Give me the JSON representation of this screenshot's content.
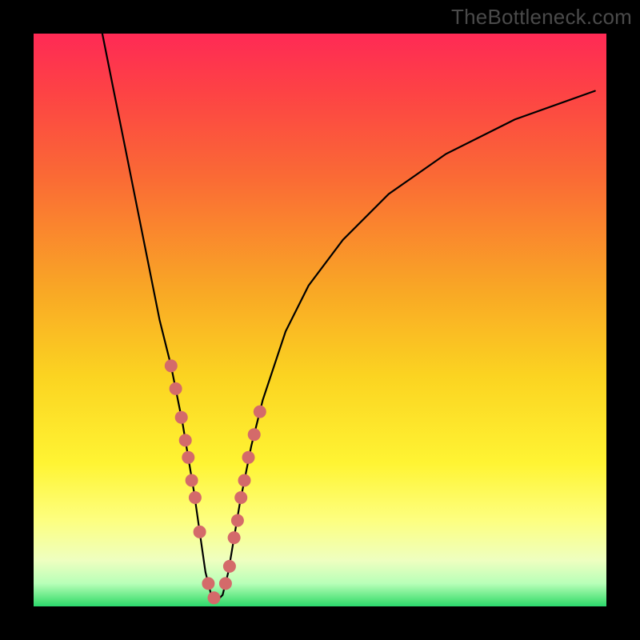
{
  "watermark": "TheBottleneck.com",
  "colors": {
    "curve_stroke": "#000000",
    "marker_fill": "#d46a6a",
    "frame_bg": "#000000",
    "gradient_top": "#ff2a55",
    "gradient_bottom": "#2bd86e"
  },
  "chart_data": {
    "type": "line",
    "title": "",
    "xlabel": "",
    "ylabel": "",
    "xlim": [
      0,
      100
    ],
    "ylim": [
      0,
      100
    ],
    "grid": false,
    "series": [
      {
        "name": "bottleneck-curve",
        "x": [
          12,
          14,
          16,
          18,
          20,
          22,
          24,
          26,
          27,
          28,
          29,
          30,
          31,
          32,
          33,
          34,
          35,
          36,
          38,
          40,
          44,
          48,
          54,
          62,
          72,
          84,
          98
        ],
        "y": [
          100,
          90,
          80,
          70,
          60,
          50,
          42,
          32,
          26,
          20,
          13,
          6,
          2,
          1,
          2,
          6,
          12,
          18,
          28,
          36,
          48,
          56,
          64,
          72,
          79,
          85,
          90
        ]
      }
    ],
    "markers": {
      "name": "highlighted-points",
      "x": [
        24.0,
        24.8,
        25.8,
        26.5,
        27.0,
        27.6,
        28.2,
        29.0,
        30.5,
        31.5,
        33.5,
        34.2,
        35.0,
        35.6,
        36.2,
        36.8,
        37.5,
        38.5,
        39.5
      ],
      "y": [
        42.0,
        38.0,
        33.0,
        29.0,
        26.0,
        22.0,
        19.0,
        13.0,
        4.0,
        1.5,
        4.0,
        7.0,
        12.0,
        15.0,
        19.0,
        22.0,
        26.0,
        30.0,
        34.0
      ],
      "radius": 8
    }
  }
}
